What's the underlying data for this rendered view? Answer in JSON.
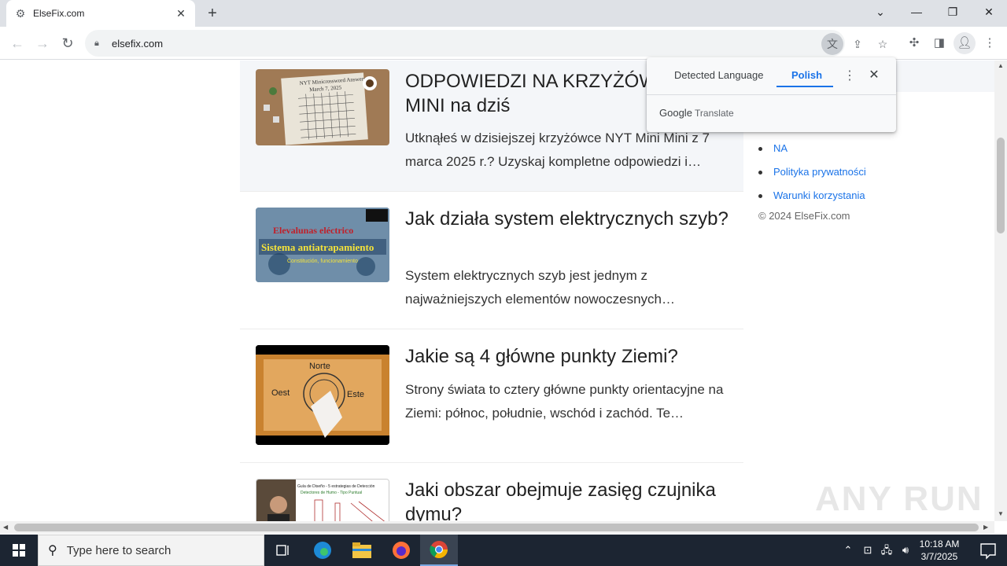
{
  "browser": {
    "tab_title": "ElseFix.com",
    "url": "elsefix.com"
  },
  "translate_popup": {
    "tab_detected": "Detected Language",
    "tab_language": "Polish",
    "brand_google": "Google",
    "brand_translate": "Translate"
  },
  "articles": [
    {
      "title": "ODPOWIEDZI NA KRZYŻÓWKĘ NYT MINI na dziś",
      "description": "Utknąłeś w dzisiejszej krzyżówce NYT Mini Mini z 7 marca 2025 r.? Uzyskaj kompletne odpowiedzi i…",
      "thumb_text_1": "NYT Minicrossword Answers",
      "thumb_text_2": "March 7, 2025"
    },
    {
      "title": "Jak działa system elektrycznych szyb?",
      "description": "System elektrycznych szyb jest jednym z najważniejszych elementów nowoczesnych…",
      "thumb_text_1": "Elevalunas eléctrico",
      "thumb_text_2": "Sistema antiatrapamiento",
      "thumb_text_3": "Constitución, funcionamiento"
    },
    {
      "title": "Jakie są 4 główne punkty Ziemi?",
      "description": "Strony świata to cztery główne punkty orientacyjne na Ziemi: północ, południe, wschód i zachód. Te…",
      "thumb_north": "Norte",
      "thumb_west": "Oest",
      "thumb_east": "Este"
    },
    {
      "title": "Jaki obszar obejmuje zasięg czujnika dymu?",
      "thumb_text_1": "Guía de Diseño - 5 estrategias de Detección",
      "thumb_text_2": "Detectores de Humo - Tipo Puntual"
    }
  ],
  "sidebar": {
    "links": [
      "NA",
      "Polityka prywatności",
      "Warunki korzystania"
    ],
    "copyright": "© 2024 ElseFix.com"
  },
  "watermark": "ANY RUN",
  "taskbar": {
    "search_placeholder": "Type here to search",
    "time": "10:18 AM",
    "date": "3/7/2025"
  }
}
